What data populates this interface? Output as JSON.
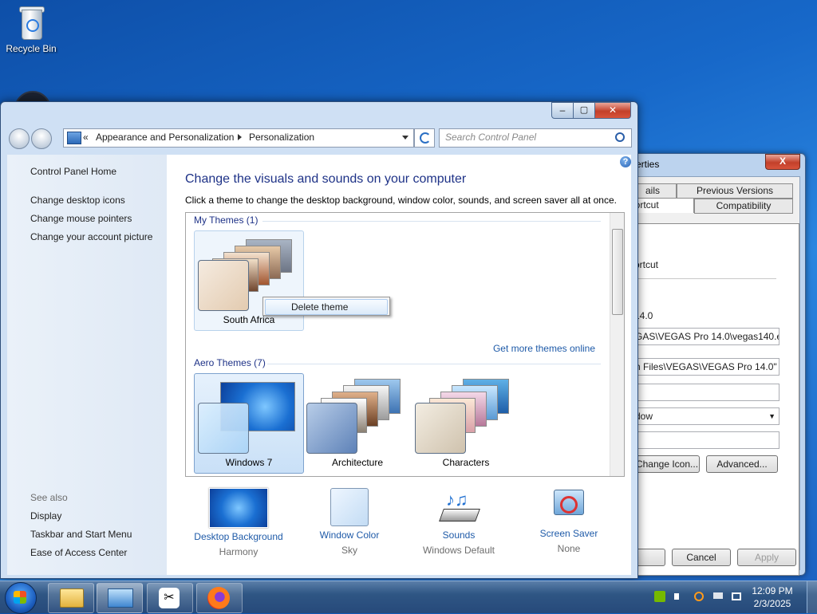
{
  "desktop": {
    "recycle_bin_label": "Recycle Bin"
  },
  "window": {
    "close_glyph": "✕",
    "minimize_glyph": "–",
    "maximize_glyph": "▢",
    "breadcrumb_prefix": "«",
    "breadcrumb": [
      "Appearance and Personalization",
      "Personalization"
    ],
    "search_placeholder": "Search Control Panel",
    "help_glyph": "?"
  },
  "sidebar": {
    "home": "Control Panel Home",
    "links": [
      "Change desktop icons",
      "Change mouse pointers",
      "Change your account picture"
    ],
    "see_also_label": "See also",
    "see_also": [
      "Display",
      "Taskbar and Start Menu",
      "Ease of Access Center"
    ]
  },
  "main": {
    "heading": "Change the visuals and sounds on your computer",
    "subheading": "Click a theme to change the desktop background, window color, sounds, and screen saver all at once.",
    "my_themes_label": "My Themes (1)",
    "aero_themes_label": "Aero Themes (7)",
    "get_more": "Get more themes online",
    "my_themes": [
      {
        "name": "South Africa"
      }
    ],
    "aero_themes": [
      {
        "name": "Windows 7"
      },
      {
        "name": "Architecture"
      },
      {
        "name": "Characters"
      }
    ],
    "context_menu": {
      "delete": "Delete theme"
    }
  },
  "bottom": [
    {
      "title": "Desktop Background",
      "value": "Harmony"
    },
    {
      "title": "Window Color",
      "value": "Sky"
    },
    {
      "title": "Sounds",
      "value": "Windows Default"
    },
    {
      "title": "Screen Saver",
      "value": "None"
    }
  ],
  "properties": {
    "title": "erties",
    "close_glyph": "X",
    "tabs": [
      "ails",
      "Previous Versions",
      "hortcut",
      "Compatibility"
    ],
    "lines": [
      "ortcut",
      "14.0"
    ],
    "target": "GAS\\VEGAS Pro 14.0\\vegas140.exe\"",
    "start_in": "n Files\\VEGAS\\VEGAS Pro 14.0\"",
    "run_value": "dow",
    "dropdown_glyph": "▼",
    "change_icon": "Change Icon...",
    "advanced": "Advanced...",
    "ok_stub": "",
    "cancel": "Cancel",
    "apply": "Apply"
  },
  "taskbar": {
    "time": "12:09 PM",
    "date": "2/3/2025",
    "capcut_glyph": "✂"
  },
  "colors": {
    "link_blue": "#1e5aa8",
    "heading_blue": "#1e3287",
    "close_red": "#c3402a"
  }
}
